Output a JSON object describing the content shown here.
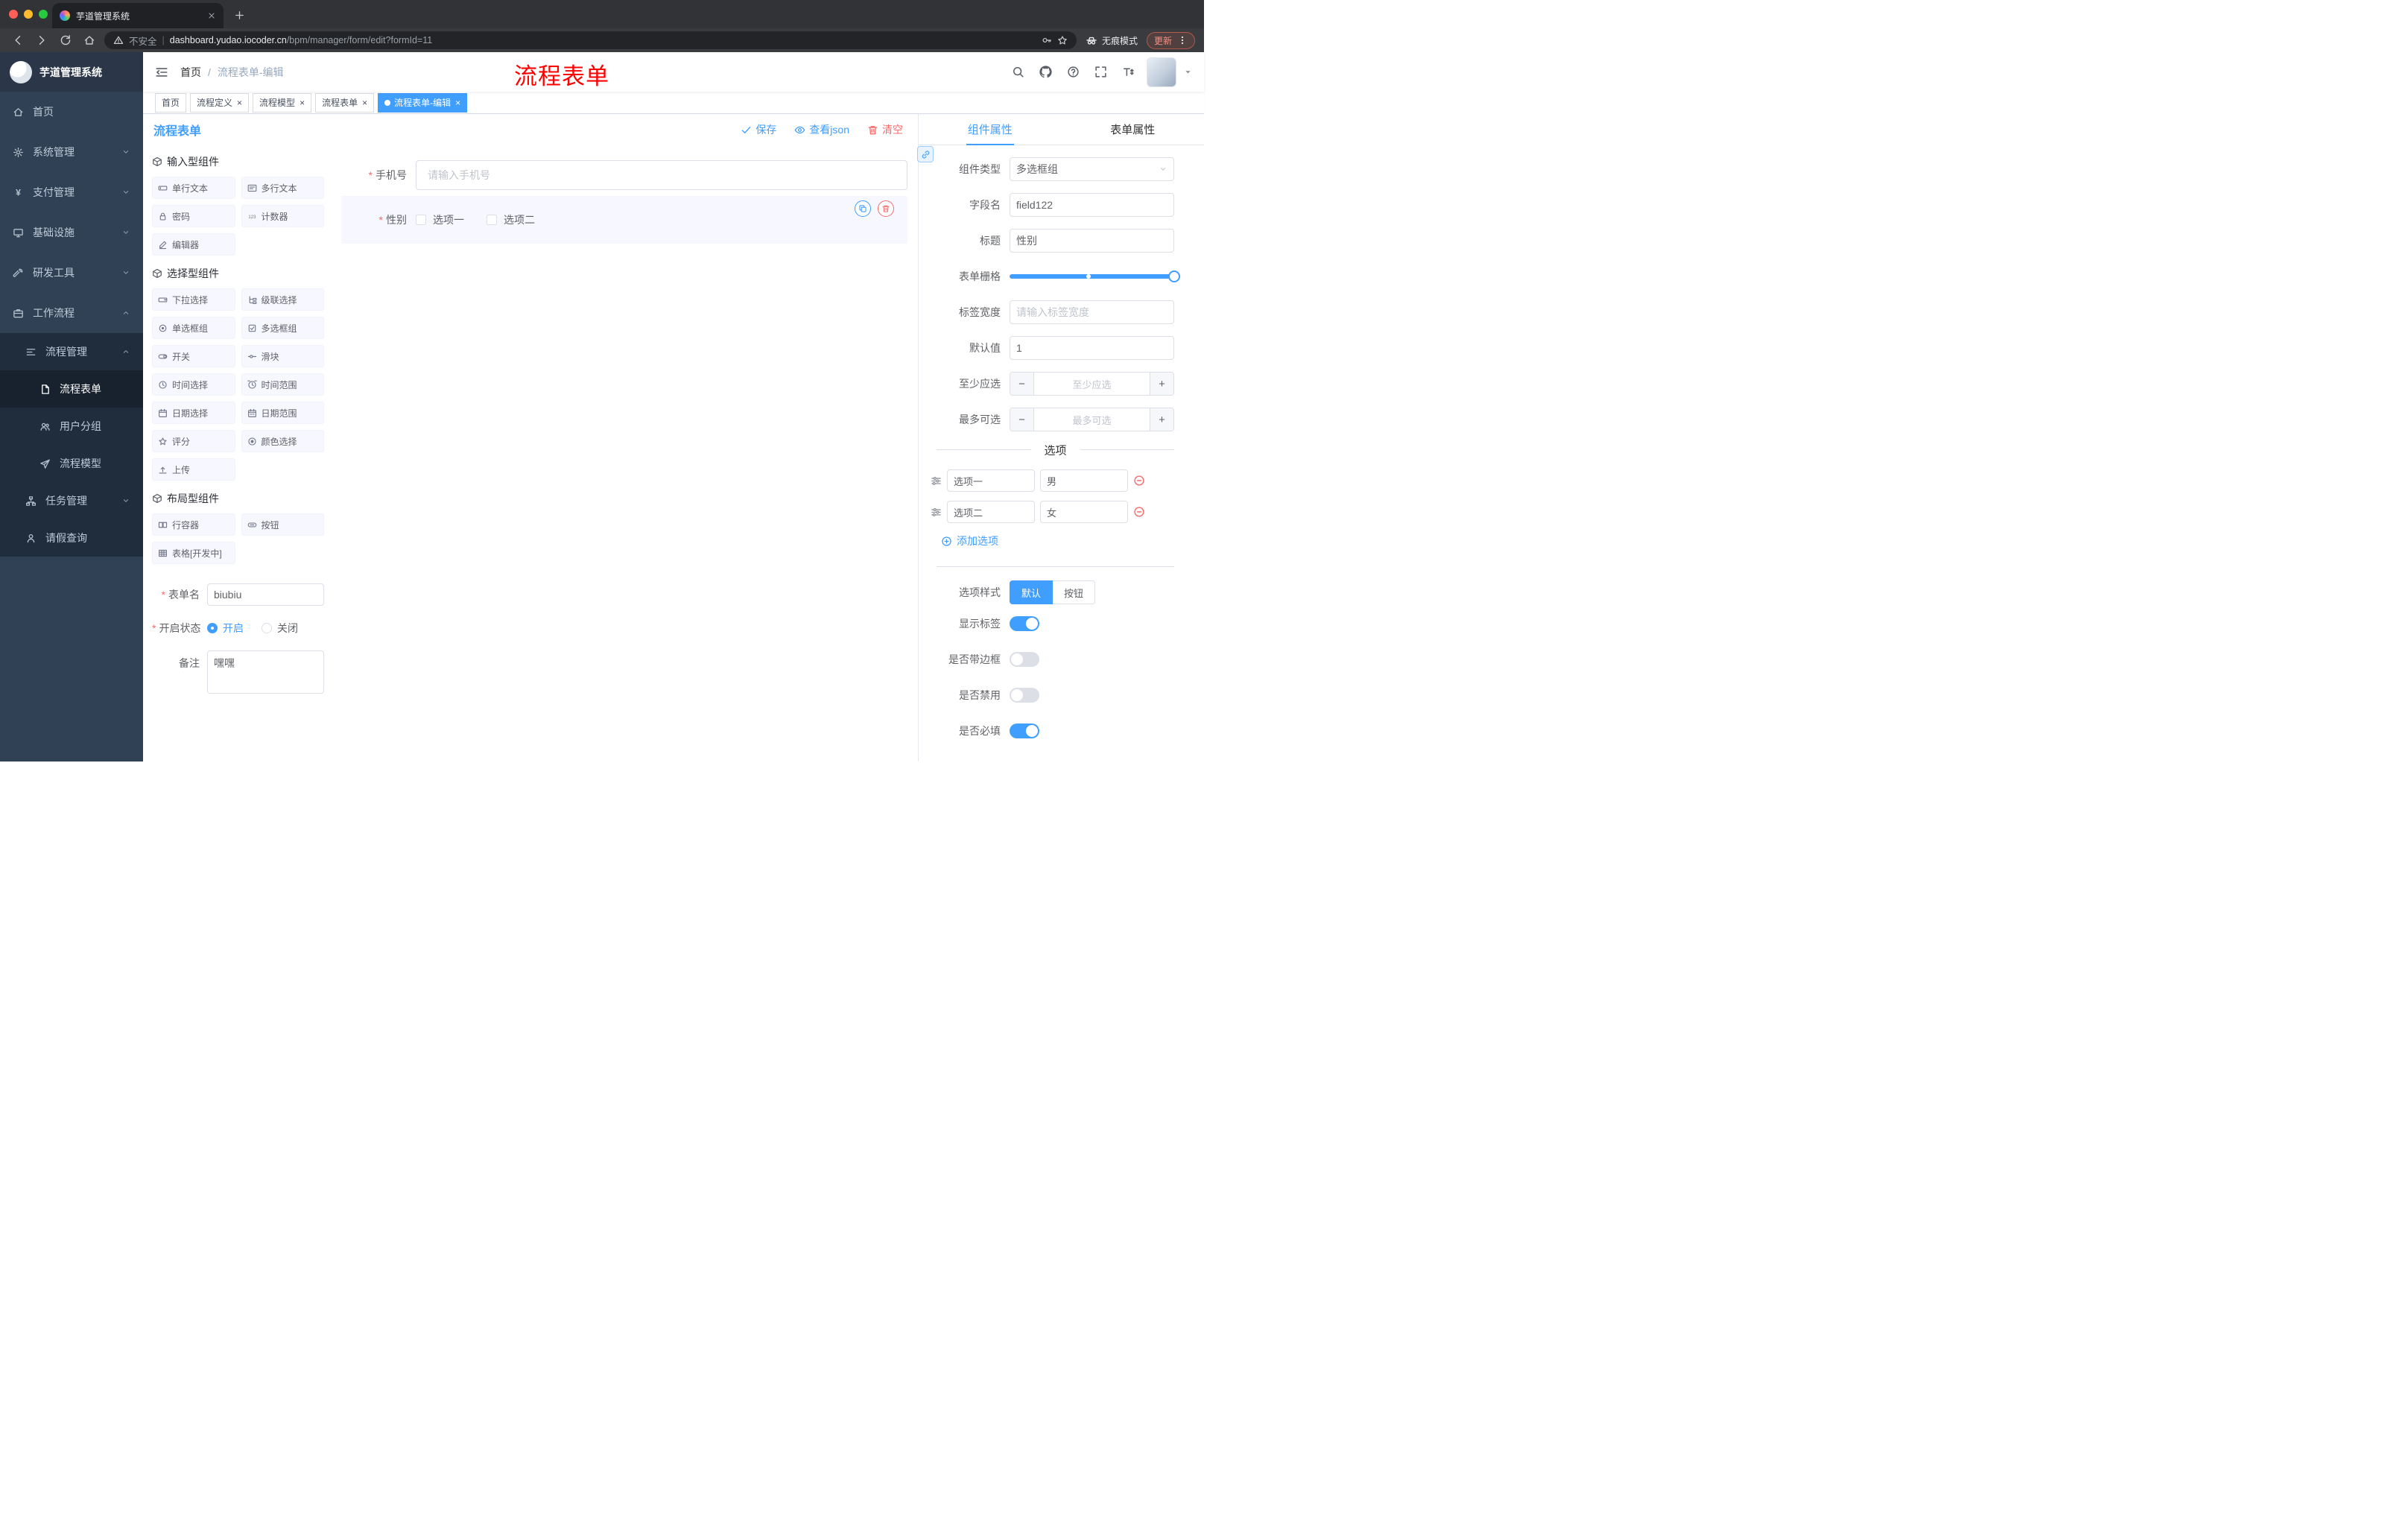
{
  "browser": {
    "tab_title": "芋道管理系统",
    "security_label": "不安全",
    "url_domain": "dashboard.yudao.iocoder.cn",
    "url_path": "/bpm/manager/form/edit?formId=11",
    "incognito_label": "无痕模式",
    "update_label": "更新"
  },
  "sidebar": {
    "title": "芋道管理系统",
    "menu": [
      {
        "label": "首页",
        "icon": "home-icon",
        "level": 0
      },
      {
        "label": "系统管理",
        "icon": "gear-icon",
        "level": 0,
        "arrow": "down"
      },
      {
        "label": "支付管理",
        "icon": "yen-icon",
        "level": 0,
        "arrow": "down"
      },
      {
        "label": "基础设施",
        "icon": "infra-icon",
        "level": 0,
        "arrow": "down"
      },
      {
        "label": "研发工具",
        "icon": "tools-icon",
        "level": 0,
        "arrow": "down"
      },
      {
        "label": "工作流程",
        "icon": "workflow-icon",
        "level": 0,
        "arrow": "up"
      },
      {
        "label": "流程管理",
        "icon": "process-icon",
        "level": 1,
        "arrow": "up"
      },
      {
        "label": "流程表单",
        "icon": "form-icon",
        "level": 2,
        "active": true
      },
      {
        "label": "用户分组",
        "icon": "users-icon",
        "level": 2
      },
      {
        "label": "流程模型",
        "icon": "model-icon",
        "level": 2
      },
      {
        "label": "任务管理",
        "icon": "task-icon",
        "level": 1,
        "arrow": "down"
      },
      {
        "label": "请假查询",
        "icon": "user-icon",
        "level": 1
      }
    ]
  },
  "header": {
    "breadcrumb": [
      "首页",
      "流程表单-编辑"
    ],
    "breadcrumb_separator": "/",
    "annotation": "流程表单",
    "icons": [
      "search-icon",
      "github-icon",
      "help-icon",
      "fullscreen-icon",
      "font-size-icon"
    ]
  },
  "tagsview": [
    {
      "label": "首页",
      "closable": false,
      "active": false
    },
    {
      "label": "流程定义",
      "closable": true,
      "active": false
    },
    {
      "label": "流程模型",
      "closable": true,
      "active": false
    },
    {
      "label": "流程表单",
      "closable": true,
      "active": false
    },
    {
      "label": "流程表单-编辑",
      "closable": true,
      "active": true
    }
  ],
  "designer": {
    "title": "流程表单",
    "save": "保存",
    "view_json": "查看json",
    "clear": "清空"
  },
  "palette": {
    "groups": [
      {
        "title": "输入型组件",
        "icon": "component-icon",
        "items": [
          {
            "label": "单行文本",
            "icon": "input-icon"
          },
          {
            "label": "多行文本",
            "icon": "textarea-icon"
          },
          {
            "label": "密码",
            "icon": "lock-icon"
          },
          {
            "label": "计数器",
            "icon": "number-icon"
          },
          {
            "label": "编辑器",
            "icon": "editor-icon"
          }
        ]
      },
      {
        "title": "选择型组件",
        "icon": "component-icon",
        "items": [
          {
            "label": "下拉选择",
            "icon": "select-icon"
          },
          {
            "label": "级联选择",
            "icon": "cascader-icon"
          },
          {
            "label": "单选框组",
            "icon": "radio-icon"
          },
          {
            "label": "多选框组",
            "icon": "checkbox-icon"
          },
          {
            "label": "开关",
            "icon": "switch-icon"
          },
          {
            "label": "滑块",
            "icon": "slider-icon"
          },
          {
            "label": "时间选择",
            "icon": "time-icon"
          },
          {
            "label": "时间范围",
            "icon": "time-range-icon"
          },
          {
            "label": "日期选择",
            "icon": "date-icon"
          },
          {
            "label": "日期范围",
            "icon": "date-range-icon"
          },
          {
            "label": "评分",
            "icon": "rate-icon"
          },
          {
            "label": "颜色选择",
            "icon": "color-icon"
          },
          {
            "label": "上传",
            "icon": "upload-icon"
          }
        ]
      },
      {
        "title": "布局型组件",
        "icon": "component-icon",
        "items": [
          {
            "label": "行容器",
            "icon": "row-icon"
          },
          {
            "label": "按钮",
            "icon": "button-icon"
          },
          {
            "label": "表格[开发中]",
            "icon": "table-icon"
          }
        ]
      }
    ]
  },
  "form_meta": {
    "name_label": "表单名",
    "name_value": "biubiu",
    "status_label": "开启状态",
    "status_options": [
      {
        "label": "开启",
        "selected": true
      },
      {
        "label": "关闭",
        "selected": false
      }
    ],
    "remark_label": "备注",
    "remark_value": "嘿嘿"
  },
  "canvas": {
    "fields": [
      {
        "type": "input",
        "label": "手机号",
        "required": true,
        "placeholder": "请输入手机号"
      },
      {
        "type": "checkbox-group",
        "label": "性别",
        "required": true,
        "options": [
          "选项一",
          "选项二"
        ],
        "selected": true
      }
    ]
  },
  "properties": {
    "tabs": [
      {
        "label": "组件属性",
        "active": true
      },
      {
        "label": "表单属性",
        "active": false
      }
    ],
    "component_type": {
      "label": "组件类型",
      "value": "多选框组"
    },
    "field_name": {
      "label": "字段名",
      "value": "field122"
    },
    "title": {
      "label": "标题",
      "value": "性别"
    },
    "grid": {
      "label": "表单栅格"
    },
    "label_width": {
      "label": "标签宽度",
      "placeholder": "请输入标签宽度"
    },
    "default_value": {
      "label": "默认值",
      "value": "1"
    },
    "min_select": {
      "label": "至少应选",
      "placeholder": "至少应选"
    },
    "max_select": {
      "label": "最多可选",
      "placeholder": "最多可选"
    },
    "options_divider": "选项",
    "options": [
      {
        "name": "选项一",
        "value": "男"
      },
      {
        "name": "选项二",
        "value": "女"
      }
    ],
    "add_option": "添加选项",
    "option_style": {
      "label": "选项样式",
      "choices": [
        {
          "label": "默认",
          "active": true
        },
        {
          "label": "按钮",
          "active": false
        }
      ]
    },
    "toggles": [
      {
        "label": "显示标签",
        "on": true
      },
      {
        "label": "是否带边框",
        "on": false
      },
      {
        "label": "是否禁用",
        "on": false
      },
      {
        "label": "是否必填",
        "on": true
      }
    ],
    "accent_color": "#409eff",
    "danger_color": "#f56c6c"
  }
}
